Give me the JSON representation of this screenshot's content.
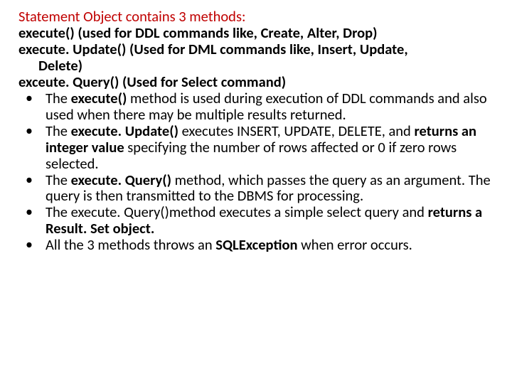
{
  "title": "Statement Object contains 3 methods:",
  "intro": {
    "line1_a": "execute()  (used for DDL commands like, Create, Alter, Drop)",
    "line2_a": "execute. Update() (Used for DML commands like, Insert, Update,",
    "line2_b": "Delete)",
    "line3_a": "exceute. Query()  (Used for Select command)"
  },
  "bullets": {
    "b1_a": "The ",
    "b1_b": "execute()",
    "b1_c": " method is used during execution of DDL commands and also used when there may be multiple results returned.",
    "b2_a": "The ",
    "b2_b": "execute. Update() ",
    "b2_c": "executes INSERT, UPDATE, DELETE, and ",
    "b2_d": "returns an integer value ",
    "b2_e": "specifying the number of rows affected or 0 if zero rows selected.",
    "b3_a": "The ",
    "b3_b": "execute. Query()",
    "b3_c": " method, which passes the query as an argument. The query is then transmitted to the DBMS for processing.",
    "b4_a": "The execute. Query()method executes a simple select query and ",
    "b4_b": "returns a Result. Set object.",
    "b5_a": "All the 3 methods throws an ",
    "b5_b": "SQLException ",
    "b5_c": "when error occurs."
  }
}
